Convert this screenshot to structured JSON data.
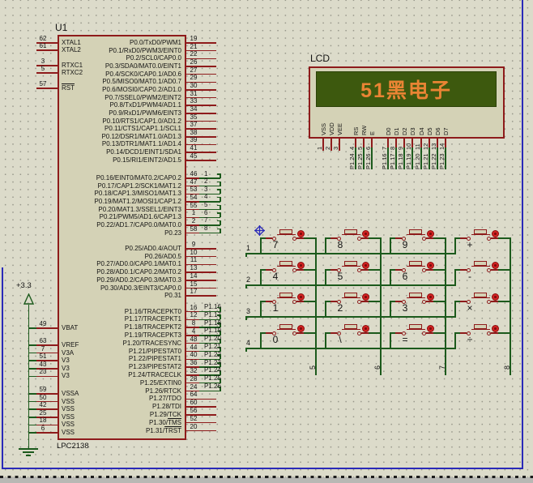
{
  "colors": {
    "background": "#dcdbca",
    "wire_green": "#1c5a1c",
    "component_maroon": "#8e1b1b",
    "component_fill": "#d4d2b6",
    "lcd_screen": "#3d590e",
    "lcd_text_orange": "#ea8434",
    "button_red": "#d42222",
    "sheet_border_blue": "#2a2ab8"
  },
  "mcu": {
    "ref": "U1",
    "part": "LPC2138",
    "pin_groups": [
      {
        "id": "xtal",
        "side": "left",
        "pins": [
          {
            "num": "62",
            "label": "XTAL1"
          },
          {
            "num": "61",
            "label": "XTAL2"
          }
        ]
      },
      {
        "id": "rtxc",
        "side": "left",
        "pins": [
          {
            "num": "3",
            "label": "RTXC1"
          },
          {
            "num": "5",
            "label": "RTXC2"
          }
        ]
      },
      {
        "id": "rst",
        "side": "left",
        "pins": [
          {
            "num": "57",
            "label": "",
            "ov": "RST"
          }
        ]
      },
      {
        "id": "vbat",
        "side": "left",
        "pins": [
          {
            "num": "49",
            "label": "VBAT",
            "wire": true
          }
        ]
      },
      {
        "id": "v3",
        "side": "left",
        "pins": [
          {
            "num": "63",
            "label": "VREF",
            "wire": true
          },
          {
            "num": "7",
            "label": "V3A",
            "wire": true
          },
          {
            "num": "51",
            "label": "V3",
            "wire": true
          },
          {
            "num": "43",
            "label": "V3",
            "wire": true
          },
          {
            "num": "23",
            "label": "V3",
            "wire": true
          }
        ]
      },
      {
        "id": "vss",
        "side": "left",
        "pins": [
          {
            "num": "59",
            "label": "VSSA",
            "wire": true
          },
          {
            "num": "50",
            "label": "VSS",
            "wire": true
          },
          {
            "num": "42",
            "label": "VSS",
            "wire": true
          },
          {
            "num": "25",
            "label": "VSS",
            "wire": true
          },
          {
            "num": "18",
            "label": "VSS",
            "wire": true
          },
          {
            "num": "6",
            "label": "VSS",
            "wire": true
          }
        ]
      },
      {
        "id": "p0a",
        "side": "right",
        "pins": [
          {
            "num": "19",
            "label": "P0.0/TxD0/PWM1"
          },
          {
            "num": "21",
            "label": "P0.1/RxD0/PWM3/EINT0"
          },
          {
            "num": "22",
            "label": "P0.2/SCL0/CAP0.0"
          },
          {
            "num": "26",
            "label": "P0.3/SDA0/MAT0.0/EINT1"
          },
          {
            "num": "27",
            "label": "P0.4/SCK0/CAP0.1/AD0.6"
          },
          {
            "num": "29",
            "label": "P0.5/MISO0/MAT0.1/AD0.7"
          },
          {
            "num": "30",
            "label": "P0.6/MOSI0/CAP0.2/AD1.0"
          },
          {
            "num": "31",
            "label": "P0.7/SSEL0/PWM2/EINT2"
          },
          {
            "num": "33",
            "label": "P0.8/TxD1/PWM4/AD1.1"
          },
          {
            "num": "34",
            "label": "P0.9/RxD1/PWM6/EINT3"
          },
          {
            "num": "35",
            "label": "P0.10/RTS1/CAP1.0/AD1.2"
          },
          {
            "num": "37",
            "label": "P0.11/CTS1/CAP1.1/SCL1"
          },
          {
            "num": "38",
            "label": "P0.12/DSR1/MAT1.0/AD1.3"
          },
          {
            "num": "39",
            "label": "P0.13/DTR1/MAT1.1/AD1.4"
          },
          {
            "num": "41",
            "label": "P0.14/DCD1/EINT1/SDA1"
          },
          {
            "num": "45",
            "label": "P0.15/RI1/EINT2/AD1.5"
          }
        ]
      },
      {
        "id": "p0b",
        "side": "right",
        "pins": [
          {
            "num": "46",
            "label": "P0.16/EINT0/MAT0.2/CAP0.2",
            "net": "1"
          },
          {
            "num": "47",
            "label": "P0.17/CAP1.2/SCK1/MAT1.2",
            "net": "2"
          },
          {
            "num": "53",
            "label": "P0.18/CAP1.3/MISO1/MAT1.3",
            "net": "3"
          },
          {
            "num": "54",
            "label": "P0.19/MAT1.2/MOSI1/CAP1.2",
            "net": "4"
          },
          {
            "num": "55",
            "label": "P0.20/MAT1.3/SSEL1/EINT3",
            "net": "5"
          },
          {
            "num": "1",
            "label": "P0.21/PWM5/AD1.6/CAP1.3",
            "net": "6"
          },
          {
            "num": "2",
            "label": "P0.22/AD1.7/CAP0.0/MAT0.0",
            "net": "7"
          },
          {
            "num": "58",
            "label": "P0.23",
            "net": "8"
          }
        ]
      },
      {
        "id": "p0c",
        "side": "right",
        "pins": [
          {
            "num": "9",
            "label": "P0.25/AD0.4/AOUT"
          },
          {
            "num": "10",
            "label": "P0.26/AD0.5"
          },
          {
            "num": "11",
            "label": "P0.27/AD0.0/CAP0.1/MAT0.1"
          },
          {
            "num": "13",
            "label": "P0.28/AD0.1/CAP0.2/MAT0.2"
          },
          {
            "num": "14",
            "label": "P0.29/AD0.2/CAP0.3/MAT0.3"
          },
          {
            "num": "15",
            "label": "P0.30/AD0.3/EINT3/CAP0.0"
          },
          {
            "num": "17",
            "label": "P0.31"
          }
        ]
      },
      {
        "id": "p1",
        "side": "right",
        "pins": [
          {
            "num": "16",
            "label": "P1.16/TRACEPKT0",
            "net": "P1.16"
          },
          {
            "num": "12",
            "label": "P1.17/TRACEPKT1",
            "net": "P1.17"
          },
          {
            "num": "8",
            "label": "P1.18/TRACEPKT2",
            "net": "P1.18"
          },
          {
            "num": "4",
            "label": "P1.19/TRACEPKT3",
            "net": "P1.19"
          },
          {
            "num": "48",
            "label": "P1.20/TRACESYNC",
            "net": "P1.20"
          },
          {
            "num": "44",
            "label": "P1.21/PIPESTAT0",
            "net": "P1.21"
          },
          {
            "num": "40",
            "label": "P1.22/PIPESTAT1",
            "net": "P1.22"
          },
          {
            "num": "36",
            "label": "P1.23/PIPESTAT2",
            "net": "P1.23"
          },
          {
            "num": "32",
            "label": "P1.24/TRACECLK",
            "net": "P1.24"
          },
          {
            "num": "28",
            "label": "P1.25/EXTIN0",
            "net": "P1.25"
          },
          {
            "num": "24",
            "label": "P1.26/RTCK",
            "net": "P1.26"
          },
          {
            "num": "64",
            "label": "P1.27/TDO"
          },
          {
            "num": "60",
            "label": "P1.28/TDI"
          },
          {
            "num": "56",
            "label": "P1.29/TCK"
          },
          {
            "num": "52",
            "label": "P1.30/",
            "ov": "TMS"
          },
          {
            "num": "20",
            "label": "P1.31/",
            "ov": "TRST"
          }
        ]
      }
    ]
  },
  "lcd": {
    "title": "LCD",
    "screen_text": "51黑电子",
    "pins": [
      {
        "num": "1",
        "name": "VSS"
      },
      {
        "num": "2",
        "name": "VDD"
      },
      {
        "num": "3",
        "name": "VEE"
      },
      {
        "num": "4",
        "name": "RS",
        "net": "P1.24"
      },
      {
        "num": "5",
        "name": "RW",
        "net": "P1.25"
      },
      {
        "num": "6",
        "name": "E",
        "net": "P1.26"
      },
      {
        "num": "7",
        "name": "D0",
        "net": "P1.16"
      },
      {
        "num": "8",
        "name": "D1",
        "net": "P1.17"
      },
      {
        "num": "9",
        "name": "D2",
        "net": "P1.18"
      },
      {
        "num": "10",
        "name": "D3",
        "net": "P1.19"
      },
      {
        "num": "11",
        "name": "D4",
        "net": "P1.20"
      },
      {
        "num": "12",
        "name": "D5",
        "net": "P1.21"
      },
      {
        "num": "13",
        "name": "D6",
        "net": "P1.22"
      },
      {
        "num": "14",
        "name": "D7",
        "net": "P1.23"
      }
    ]
  },
  "keypad": {
    "keys": [
      [
        "7",
        "8",
        "9",
        "+"
      ],
      [
        "4",
        "5",
        "6",
        "-"
      ],
      [
        "1",
        "2",
        "3",
        "×"
      ],
      [
        "0",
        "\\",
        "=",
        "÷"
      ]
    ],
    "row_nets": [
      "1",
      "2",
      "3",
      "4"
    ],
    "col_nets": [
      "5",
      "6",
      "7",
      "8"
    ]
  },
  "power": {
    "label": "+3.3"
  }
}
